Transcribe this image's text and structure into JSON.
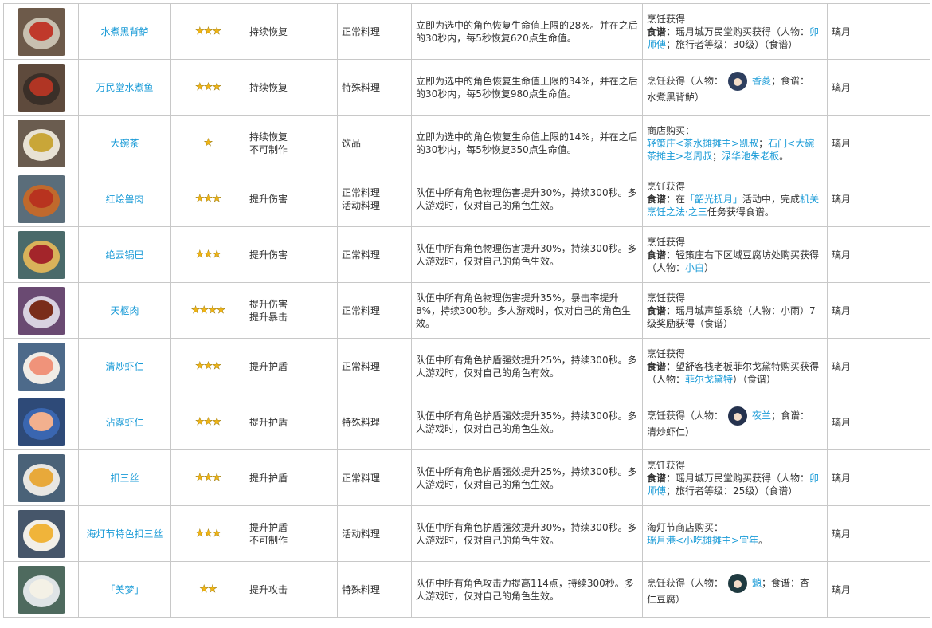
{
  "rows": [
    {
      "icon": "food-icon",
      "bg": "#6d5a4a",
      "plate": "#c8c0b0",
      "food": "#c0392b",
      "name": "水煮黑背鲈",
      "stars": "★★★",
      "effect": [
        "持续恢复"
      ],
      "type": [
        "正常料理"
      ],
      "desc": "立即为选中的角色恢复生命值上限的28%。并在之后的30秒内，每5秒恢复620点生命值。",
      "source": {
        "lines": [
          [
            {
              "t": "烹饪获得"
            }
          ],
          [
            {
              "t": "食谱：",
              "b": true
            },
            {
              "t": "瑶月城万民堂购买获得（人物："
            },
            {
              "t": "卯师傅",
              "c": "blue"
            },
            {
              "t": "；旅行者等级：30级）（食谱）"
            }
          ]
        ]
      },
      "region": "璃月"
    },
    {
      "icon": "food-icon",
      "bg": "#5e4a3c",
      "plate": "#3a2f28",
      "food": "#b03524",
      "name": "万民堂水煮鱼",
      "stars": "★★★",
      "effect": [
        "持续恢复"
      ],
      "type": [
        "特殊料理"
      ],
      "desc": "立即为选中的角色恢复生命值上限的34%，并在之后的30秒内，每5秒恢复980点生命值。",
      "source": {
        "lines": [
          [
            {
              "t": "烹饪获得（人物："
            },
            {
              "avatar": true,
              "color": "#2d3e5e"
            },
            {
              "t": "香菱",
              "c": "blue"
            },
            {
              "t": "；食谱："
            }
          ],
          [
            {
              "t": "水煮黑背鲈）"
            }
          ]
        ]
      },
      "region": "璃月"
    },
    {
      "icon": "food-icon",
      "bg": "#6a5c4f",
      "plate": "#e8e2d4",
      "food": "#c9a638",
      "name": "大碗茶",
      "stars": "★",
      "effect": [
        "持续恢复",
        "不可制作"
      ],
      "type": [
        "饮品"
      ],
      "desc": "立即为选中的角色恢复生命值上限的14%，并在之后的30秒内，每5秒恢复350点生命值。",
      "source": {
        "lines": [
          [
            {
              "t": "商店购买："
            }
          ],
          [
            {
              "t": "轻策庄<茶水摊摊主>凯叔",
              "c": "blue"
            },
            {
              "t": "；"
            },
            {
              "t": "石门<大碗茶摊主>老周叔",
              "c": "blue"
            },
            {
              "t": "；"
            },
            {
              "t": "渌华池朱老板",
              "c": "blue"
            },
            {
              "t": "。"
            }
          ]
        ]
      },
      "region": "璃月"
    },
    {
      "icon": "food-icon",
      "bg": "#5a6d7a",
      "plate": "#c0692c",
      "food": "#b8331f",
      "name": "红烩兽肉",
      "stars": "★★★",
      "effect": [
        "提升伤害"
      ],
      "type": [
        "正常料理",
        "活动料理"
      ],
      "desc": "队伍中所有角色物理伤害提升30%，持续300秒。多人游戏时，仅对自己的角色生效。",
      "source": {
        "lines": [
          [
            {
              "t": "烹饪获得"
            }
          ],
          [
            {
              "t": "食谱：",
              "b": true
            },
            {
              "t": "在"
            },
            {
              "t": "「韶光抚月」",
              "c": "blue"
            },
            {
              "t": "活动中，完成"
            },
            {
              "t": "机关烹饪之法·之三",
              "c": "blue"
            },
            {
              "t": "任务获得食谱。"
            }
          ]
        ]
      },
      "region": "璃月"
    },
    {
      "icon": "food-icon",
      "bg": "#4a6a6a",
      "plate": "#d9b25a",
      "food": "#a3252a",
      "name": "绝云锅巴",
      "stars": "★★★",
      "effect": [
        "提升伤害"
      ],
      "type": [
        "正常料理"
      ],
      "desc": "队伍中所有角色物理伤害提升30%，持续300秒。多人游戏时，仅对自己的角色生效。",
      "source": {
        "lines": [
          [
            {
              "t": "烹饪获得"
            }
          ],
          [
            {
              "t": "食谱：",
              "b": true
            },
            {
              "t": "轻策庄右下区域豆腐坊处购买获得"
            }
          ],
          [
            {
              "t": "（人物："
            },
            {
              "t": "小白",
              "c": "blue"
            },
            {
              "t": "）"
            }
          ]
        ]
      },
      "region": "璃月"
    },
    {
      "icon": "food-icon",
      "bg": "#6a4a72",
      "plate": "#d8d2e0",
      "food": "#7a2d1a",
      "name": "天枢肉",
      "stars": "★★★★",
      "effect": [
        "提升伤害",
        "提升暴击"
      ],
      "type": [
        "正常料理"
      ],
      "desc": "队伍中所有角色物理伤害提升35%，暴击率提升8%，持续300秒。多人游戏时，仅对自己的角色生效。",
      "source": {
        "lines": [
          [
            {
              "t": "烹饪获得"
            }
          ],
          [
            {
              "t": "食谱：",
              "b": true
            },
            {
              "t": "瑶月城声望系统（人物：小雨）7级奖励获得（食谱）"
            }
          ]
        ]
      },
      "region": "璃月"
    },
    {
      "icon": "food-icon",
      "bg": "#4d6a8a",
      "plate": "#f0ece6",
      "food": "#f0937a",
      "name": "清炒虾仁",
      "stars": "★★★",
      "effect": [
        "提升护盾"
      ],
      "type": [
        "正常料理"
      ],
      "desc": "队伍中所有角色护盾强效提升25%，持续300秒。多人游戏时，仅对自己的角色有效。",
      "source": {
        "lines": [
          [
            {
              "t": "烹饪获得"
            }
          ],
          [
            {
              "t": "食谱：",
              "b": true
            },
            {
              "t": "望舒客栈老板菲尔戈黛特购买获得"
            }
          ],
          [
            {
              "t": "（人物："
            },
            {
              "t": "菲尔戈黛特",
              "c": "blue"
            },
            {
              "t": "）（食谱）"
            }
          ]
        ]
      },
      "region": "璃月"
    },
    {
      "icon": "food-icon",
      "bg": "#2e4a78",
      "plate": "#3a66b0",
      "food": "#f2b08e",
      "name": "沾露虾仁",
      "stars": "★★★",
      "effect": [
        "提升护盾"
      ],
      "type": [
        "特殊料理"
      ],
      "desc": "队伍中所有角色护盾强效提升35%，持续300秒。多人游戏时，仅对自己的角色生效。",
      "source": {
        "lines": [
          [
            {
              "t": "烹饪获得（人物："
            },
            {
              "avatar": true,
              "color": "#25324e"
            },
            {
              "t": "夜兰",
              "c": "blue"
            },
            {
              "t": "；食谱："
            }
          ],
          [
            {
              "t": "清炒虾仁）"
            }
          ]
        ]
      },
      "region": "璃月"
    },
    {
      "icon": "food-icon",
      "bg": "#4a6278",
      "plate": "#e8e6e2",
      "food": "#e8a93a",
      "name": "扣三丝",
      "stars": "★★★",
      "effect": [
        "提升护盾"
      ],
      "type": [
        "正常料理"
      ],
      "desc": "队伍中所有角色护盾强效提升25%，持续300秒。多人游戏时，仅对自己的角色生效。",
      "source": {
        "lines": [
          [
            {
              "t": "烹饪获得"
            }
          ],
          [
            {
              "t": "食谱：",
              "b": true
            },
            {
              "t": "瑶月城万民堂购买获得（人物："
            },
            {
              "t": "卯师傅",
              "c": "blue"
            },
            {
              "t": "；旅行者等级：25级）（食谱）"
            }
          ]
        ]
      },
      "region": "璃月"
    },
    {
      "icon": "food-icon",
      "bg": "#46566a",
      "plate": "#f2efe8",
      "food": "#f0b43a",
      "name": "海灯节特色扣三丝",
      "stars": "★★★",
      "effect": [
        "提升护盾",
        "不可制作"
      ],
      "type": [
        "活动料理"
      ],
      "desc": "队伍中所有角色护盾强效提升30%，持续300秒。多人游戏时，仅对自己的角色生效。",
      "source": {
        "lines": [
          [
            {
              "t": "海灯节商店购买："
            }
          ],
          [
            {
              "t": "瑶月港<小吃摊摊主>宜年",
              "c": "blue"
            },
            {
              "t": "。"
            }
          ]
        ]
      },
      "region": "璃月"
    },
    {
      "icon": "food-icon",
      "bg": "#4e6a5e",
      "plate": "#dfe4e6",
      "food": "#f4f1e6",
      "name": "「美梦」",
      "stars": "★★",
      "effect": [
        "提升攻击"
      ],
      "type": [
        "特殊料理"
      ],
      "desc": "队伍中所有角色攻击力提高114点，持续300秒。多人游戏时，仅对自己的角色生效。",
      "source": {
        "lines": [
          [
            {
              "t": "烹饪获得（人物："
            },
            {
              "avatar": true,
              "color": "#1f3a40"
            },
            {
              "t": "魈",
              "c": "blue"
            },
            {
              "t": "；食谱：杏"
            }
          ],
          [
            {
              "t": "仁豆腐）"
            }
          ]
        ]
      },
      "region": "璃月"
    }
  ]
}
